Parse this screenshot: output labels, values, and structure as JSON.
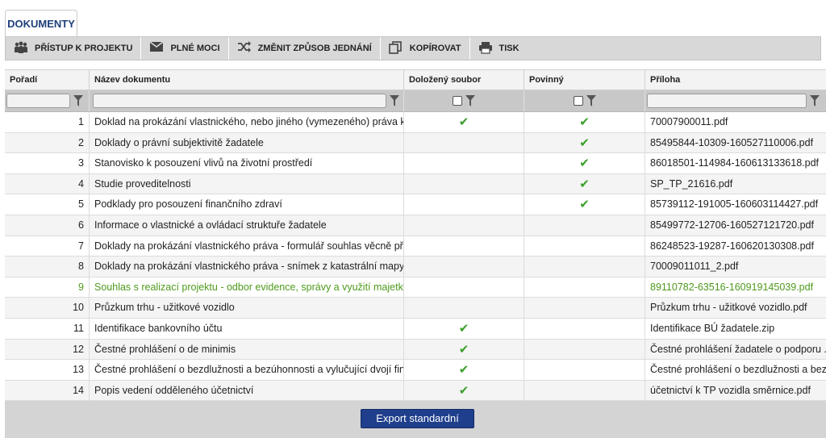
{
  "tab": {
    "label": "DOKUMENTY"
  },
  "toolbar": [
    {
      "label": "PŘÍSTUP K PROJEKTU",
      "icon": "people-icon"
    },
    {
      "label": "PLNÉ MOCI",
      "icon": "envelope-icon"
    },
    {
      "label": "ZMĚNIT ZPŮSOB JEDNÁNÍ",
      "icon": "shuffle-icon"
    },
    {
      "label": "KOPÍROVAT",
      "icon": "copy-icon"
    },
    {
      "label": "TISK",
      "icon": "printer-icon"
    }
  ],
  "table": {
    "headers": [
      "Pořadí",
      "Název dokumentu",
      "Doložený soubor",
      "Povinný",
      "Příloha"
    ],
    "rows": [
      {
        "num": "1",
        "name": "Doklad na prokázání vlastnického, nebo jiného (vymezeného) práva k m...",
        "file": true,
        "req": true,
        "att": "70007900011.pdf"
      },
      {
        "num": "2",
        "name": "Doklady o právní subjektivitě žadatele",
        "file": false,
        "req": true,
        "att": "85495844-10309-160527110006.pdf"
      },
      {
        "num": "3",
        "name": "Stanovisko k posouzení vlivů na životní prostředí",
        "file": false,
        "req": true,
        "att": "86018501-114984-160613133618.pdf"
      },
      {
        "num": "4",
        "name": "Studie proveditelnosti",
        "file": false,
        "req": true,
        "att": "SP_TP_21616.pdf"
      },
      {
        "num": "5",
        "name": "Podklady pro posouzení finančního zdraví",
        "file": false,
        "req": true,
        "att": "85739112-191005-160603114427.pdf"
      },
      {
        "num": "6",
        "name": "Informace o vlastnické a ovládací struktuře žadatele",
        "file": false,
        "req": false,
        "att": "85499772-12706-160527121720.pdf"
      },
      {
        "num": "7",
        "name": "Doklady na prokázání vlastnického práva - formulář souhlas věcně přísl...",
        "file": false,
        "req": false,
        "att": "86248523-19287-160620130308.pdf"
      },
      {
        "num": "8",
        "name": "Doklady na prokázání vlastnického práva - snímek z katastrální mapy",
        "file": false,
        "req": false,
        "att": "70009011011_2.pdf"
      },
      {
        "num": "9",
        "name": "Souhlas s realizací projektu - odbor evidence, správy a využití majetku ...",
        "file": false,
        "req": false,
        "att": "89110782-63516-160919145039.pdf",
        "highlight": true
      },
      {
        "num": "10",
        "name": "Průzkum trhu - užitkové vozidlo",
        "file": false,
        "req": false,
        "att": "Průzkum trhu - užitkové vozidlo.pdf"
      },
      {
        "num": "11",
        "name": "Identifikace bankovního účtu",
        "file": true,
        "req": false,
        "att": "Identifikace BÚ žadatele.zip"
      },
      {
        "num": "12",
        "name": "Čestné prohlášení o de minimis",
        "file": true,
        "req": false,
        "att": "Čestné prohlášení žadatele o podporu ..."
      },
      {
        "num": "13",
        "name": "Čestné prohlášení o bezdlužnosti a bezúhonnosti a vylučující dvojí finan...",
        "file": true,
        "req": false,
        "att": "Čestné prohlášení o bezdlužnosti a bez..."
      },
      {
        "num": "14",
        "name": "Popis vedení odděleného účetnictví",
        "file": true,
        "req": false,
        "att": "účetnictví k TP vozidla směrnice.pdf"
      }
    ]
  },
  "footer": {
    "export_label": "Export standardní"
  },
  "colors": {
    "accent": "#1f3f8c",
    "highlight": "#4e9a1c",
    "check": "#3aa02a"
  }
}
